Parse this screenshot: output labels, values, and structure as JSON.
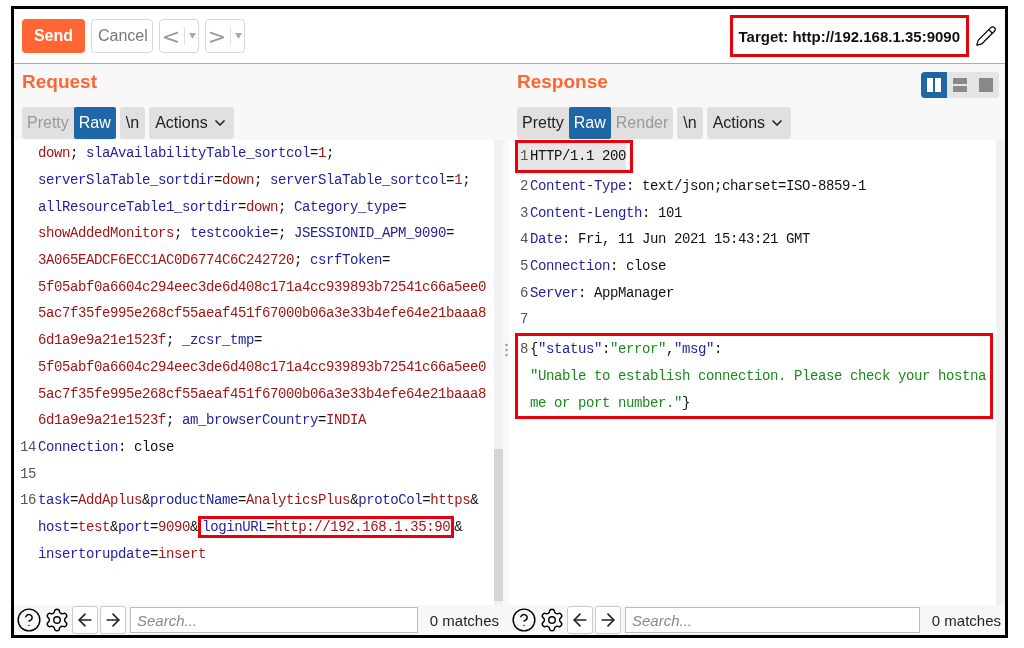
{
  "toolbar": {
    "send": "Send",
    "cancel": "Cancel",
    "back": "<",
    "forward": ">",
    "target": "Target: http://192.168.1.35:9090",
    "target_boxed": true
  },
  "request": {
    "title": "Request",
    "tabs": [
      {
        "label": "Pretty",
        "selected": false,
        "disabled": true
      },
      {
        "label": "Raw",
        "selected": true,
        "disabled": false
      }
    ],
    "newline_button": "\\n",
    "actions": "Actions",
    "lines": [
      {
        "tokens": [
          {
            "kind": "value",
            "text": "down"
          },
          {
            "kind": "plain",
            "text": "; "
          },
          {
            "kind": "key",
            "text": "slaAvailabilityTable_sortcol"
          },
          {
            "kind": "plain",
            "text": "="
          },
          {
            "kind": "value",
            "text": "1"
          },
          {
            "kind": "plain",
            "text": ";"
          }
        ]
      },
      {
        "tokens": [
          {
            "kind": "key",
            "text": "serverSlaTable_sortdir"
          },
          {
            "kind": "plain",
            "text": "="
          },
          {
            "kind": "value",
            "text": "down"
          },
          {
            "kind": "plain",
            "text": "; "
          },
          {
            "kind": "key",
            "text": "serverSlaTable_sortcol"
          },
          {
            "kind": "plain",
            "text": "="
          },
          {
            "kind": "value",
            "text": "1"
          },
          {
            "kind": "plain",
            "text": ";"
          }
        ]
      },
      {
        "tokens": [
          {
            "kind": "key",
            "text": "allResourceTable1_sortdir"
          },
          {
            "kind": "plain",
            "text": "="
          },
          {
            "kind": "value",
            "text": "down"
          },
          {
            "kind": "plain",
            "text": "; "
          },
          {
            "kind": "key",
            "text": "Category_type"
          },
          {
            "kind": "plain",
            "text": "="
          }
        ]
      },
      {
        "tokens": [
          {
            "kind": "value",
            "text": "showAddedMonitors"
          },
          {
            "kind": "plain",
            "text": "; "
          },
          {
            "kind": "key",
            "text": "testcookie"
          },
          {
            "kind": "plain",
            "text": "=; "
          },
          {
            "kind": "key",
            "text": "JSESSIONID_APM_9090"
          },
          {
            "kind": "plain",
            "text": "="
          }
        ]
      },
      {
        "tokens": [
          {
            "kind": "value",
            "text": "3A065EADCF6ECC1AC0D6774C6C242720"
          },
          {
            "kind": "plain",
            "text": "; "
          },
          {
            "kind": "key",
            "text": "csrfToken"
          },
          {
            "kind": "plain",
            "text": "="
          }
        ]
      },
      {
        "tokens": [
          {
            "kind": "value",
            "text": "5f05abf0a6604c294eec3de6d408c171a4cc939893b72541c66a5ee0"
          }
        ]
      },
      {
        "tokens": [
          {
            "kind": "value",
            "text": "5ac7f35fe995e268cf55aeaf451f67000b06a3e33b4efe64e21baaa8"
          }
        ]
      },
      {
        "tokens": [
          {
            "kind": "value",
            "text": "6d1a9e9a21e1523f"
          },
          {
            "kind": "plain",
            "text": "; "
          },
          {
            "kind": "key",
            "text": "_zcsr_tmp"
          },
          {
            "kind": "plain",
            "text": "="
          }
        ]
      },
      {
        "tokens": [
          {
            "kind": "value",
            "text": "5f05abf0a6604c294eec3de6d408c171a4cc939893b72541c66a5ee0"
          }
        ]
      },
      {
        "tokens": [
          {
            "kind": "value",
            "text": "5ac7f35fe995e268cf55aeaf451f67000b06a3e33b4efe64e21baaa8"
          }
        ]
      },
      {
        "tokens": [
          {
            "kind": "value",
            "text": "6d1a9e9a21e1523f"
          },
          {
            "kind": "plain",
            "text": "; "
          },
          {
            "kind": "key",
            "text": "am_browserCountry"
          },
          {
            "kind": "plain",
            "text": "="
          },
          {
            "kind": "value",
            "text": "INDIA"
          }
        ]
      },
      {
        "number": "14",
        "tokens": [
          {
            "kind": "key",
            "text": "Connection"
          },
          {
            "kind": "plain",
            "text": ": close"
          }
        ]
      },
      {
        "number": "15"
      },
      {
        "number": "16",
        "tokens": [
          {
            "kind": "key",
            "text": "task"
          },
          {
            "kind": "plain",
            "text": "="
          },
          {
            "kind": "value",
            "text": "AddAplus"
          },
          {
            "kind": "plain",
            "text": "&"
          },
          {
            "kind": "key",
            "text": "productName"
          },
          {
            "kind": "plain",
            "text": "="
          },
          {
            "kind": "value",
            "text": "AnalyticsPlus"
          },
          {
            "kind": "plain",
            "text": "&"
          },
          {
            "kind": "key",
            "text": "protoCol"
          },
          {
            "kind": "plain",
            "text": "="
          },
          {
            "kind": "value",
            "text": "https"
          },
          {
            "kind": "plain",
            "text": "&"
          }
        ]
      },
      {
        "tokens": [
          {
            "kind": "key",
            "text": "host"
          },
          {
            "kind": "plain",
            "text": "="
          },
          {
            "kind": "value",
            "text": "test"
          },
          {
            "kind": "plain",
            "text": "&"
          },
          {
            "kind": "key",
            "text": "port"
          },
          {
            "kind": "plain",
            "text": "="
          },
          {
            "kind": "value",
            "text": "9090"
          },
          {
            "kind": "plain",
            "text": "&"
          },
          {
            "kind": "key",
            "text": "loginURL",
            "boxed": true
          },
          {
            "kind": "plain",
            "text": "=",
            "boxed": true
          },
          {
            "kind": "value",
            "text": "http://192.168.1.35:90",
            "boxed": true
          },
          {
            "kind": "plain",
            "text": "&"
          }
        ]
      },
      {
        "tokens": [
          {
            "kind": "key",
            "text": "insertorupdate"
          },
          {
            "kind": "plain",
            "text": "="
          },
          {
            "kind": "value",
            "text": "insert"
          }
        ]
      }
    ],
    "search": {
      "placeholder": "Search...",
      "matches": "0 matches"
    }
  },
  "response": {
    "title": "Response",
    "view_modes": [
      {
        "kind": "split",
        "selected": true
      },
      {
        "kind": "stacked",
        "selected": false
      },
      {
        "kind": "single",
        "selected": false
      }
    ],
    "tabs": [
      {
        "label": "Pretty",
        "selected": false,
        "disabled": false
      },
      {
        "label": "Raw",
        "selected": true,
        "disabled": false
      },
      {
        "label": "Render",
        "selected": false,
        "disabled": true
      }
    ],
    "newline_button": "\\n",
    "actions": "Actions",
    "groups": [
      {
        "boxed": true,
        "lines": [
          {
            "number": "1",
            "selected": true,
            "tokens": [
              {
                "kind": "plain",
                "text": "HTTP/1.1 200"
              }
            ]
          }
        ]
      },
      {
        "lines": [
          {
            "number": "2",
            "selected": false,
            "tokens": [
              {
                "kind": "key",
                "text": "Content-Type"
              },
              {
                "kind": "plain",
                "text": ": text/json;charset=ISO-8859-1"
              }
            ]
          },
          {
            "number": "3",
            "selected": false,
            "tokens": [
              {
                "kind": "key",
                "text": "Content-Length"
              },
              {
                "kind": "plain",
                "text": ": 101"
              }
            ]
          },
          {
            "number": "4",
            "selected": false,
            "tokens": [
              {
                "kind": "key",
                "text": "Date"
              },
              {
                "kind": "plain",
                "text": ": Fri, 11 Jun 2021 15:43:21 GMT"
              }
            ]
          },
          {
            "number": "5",
            "selected": false,
            "tokens": [
              {
                "kind": "key",
                "text": "Connection"
              },
              {
                "kind": "plain",
                "text": ": close"
              }
            ]
          },
          {
            "number": "6",
            "selected": false,
            "tokens": [
              {
                "kind": "key",
                "text": "Server"
              },
              {
                "kind": "plain",
                "text": ": AppManager"
              }
            ]
          },
          {
            "number": "7",
            "selected": false
          }
        ]
      },
      {
        "boxed": true,
        "lines": [
          {
            "number": "8",
            "selected": false,
            "tokens": [
              {
                "kind": "plain",
                "text": "{"
              },
              {
                "kind": "key",
                "text": "\"status\""
              },
              {
                "kind": "plain",
                "text": ":"
              },
              {
                "kind": "string",
                "text": "\"error\""
              },
              {
                "kind": "plain",
                "text": ","
              },
              {
                "kind": "key",
                "text": "\"msg\""
              },
              {
                "kind": "plain",
                "text": ":"
              }
            ]
          },
          {
            "selected": false,
            "tokens": [
              {
                "kind": "string",
                "text": "\"Unable to establish connection. Please check your hostna"
              }
            ]
          },
          {
            "selected": false,
            "tokens": [
              {
                "kind": "string",
                "text": "me or port number.\""
              },
              {
                "kind": "plain",
                "text": "}"
              }
            ]
          }
        ]
      }
    ],
    "search": {
      "placeholder": "Search...",
      "matches": "0 matches"
    }
  }
}
